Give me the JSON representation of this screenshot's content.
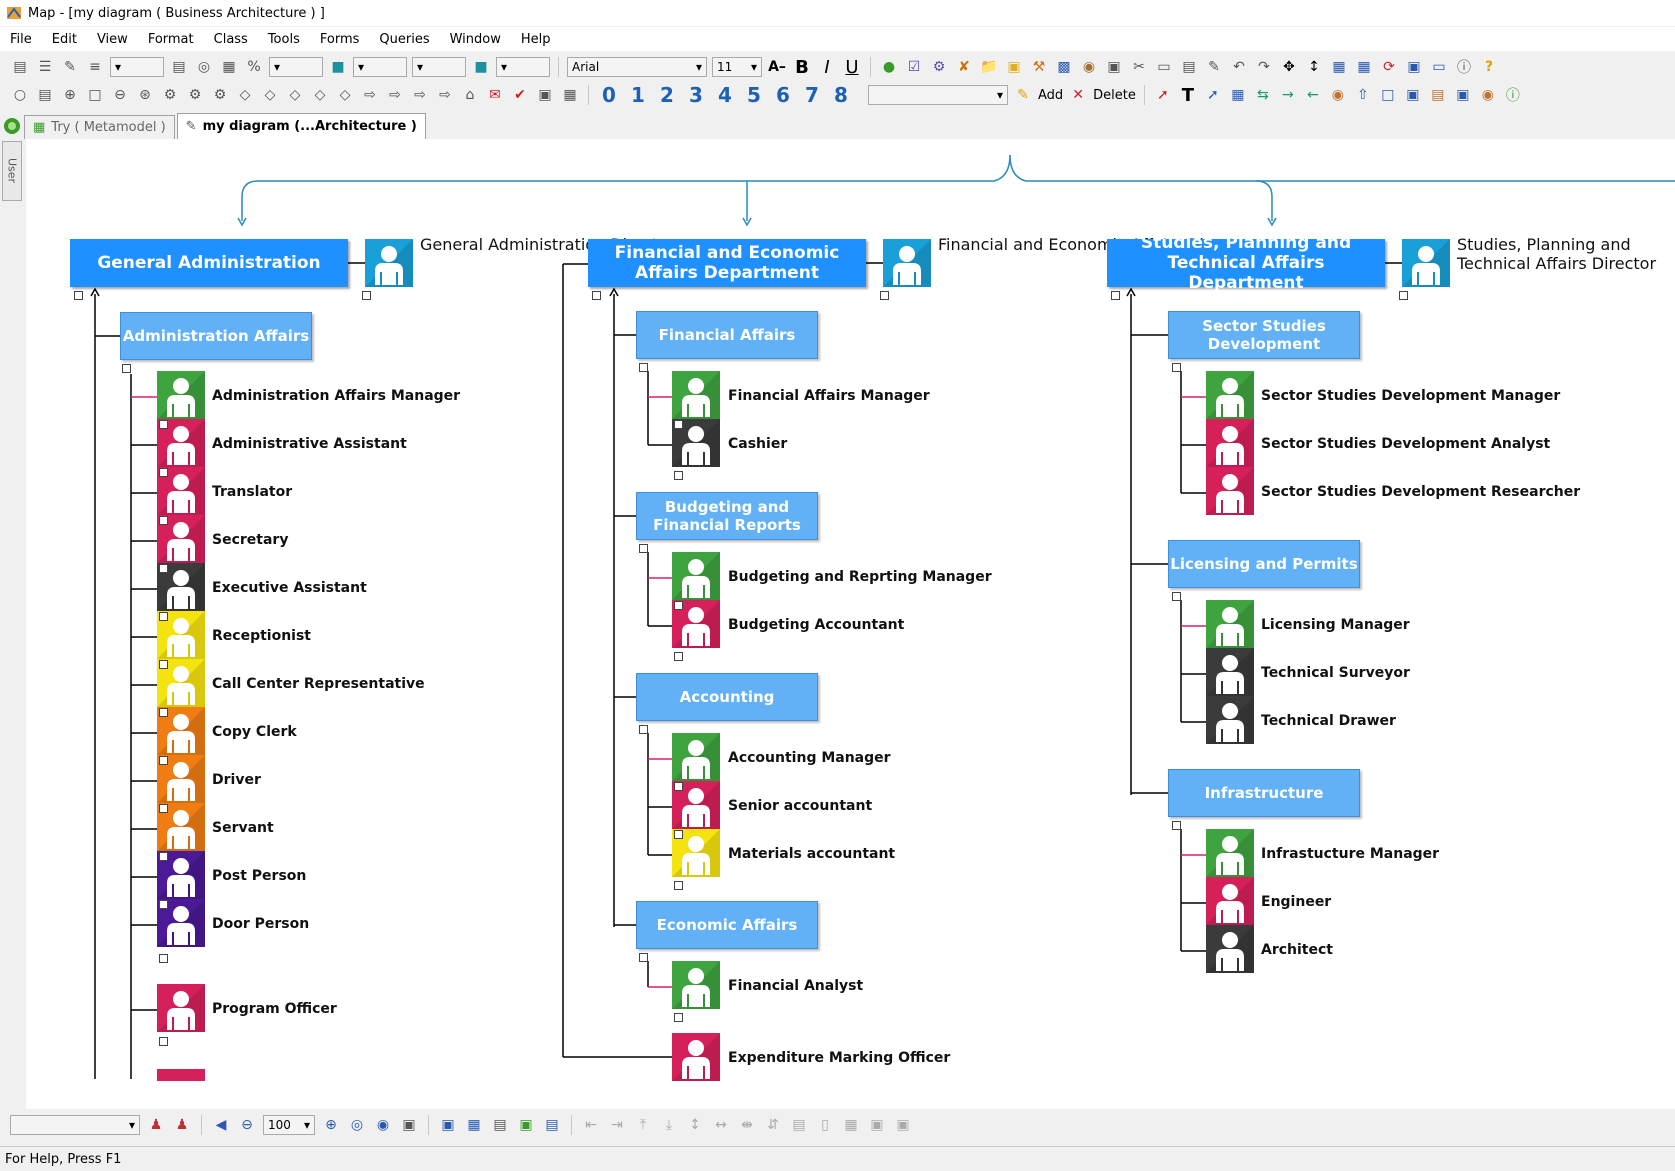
{
  "window": {
    "title": "Map - [my diagram ( Business Architecture ) ]"
  },
  "menu": [
    "File",
    "Edit",
    "View",
    "Format",
    "Class",
    "Tools",
    "Forms",
    "Queries",
    "Window",
    "Help"
  ],
  "toolbar": {
    "font_name": "Arial",
    "font_size": "11",
    "add_label": "Add",
    "delete_label": "Delete",
    "number_tools": [
      "0",
      "1",
      "2",
      "3",
      "4",
      "5",
      "6",
      "7",
      "8"
    ]
  },
  "tabs": [
    {
      "label": "Try ( Metamodel )"
    },
    {
      "label": "my diagram (...Architecture )"
    }
  ],
  "sidebar": {
    "label": "User"
  },
  "colors": {
    "green": "#3fa33f",
    "crimson": "#d6205a",
    "darkgray": "#3b3b3b",
    "yellow": "#f5e30f",
    "orange": "#f07d13",
    "purple": "#4b1a96",
    "teal": "#1aa0d8"
  },
  "diagram": {
    "departments": [
      {
        "name": "General Administration",
        "director": "General Administration Director"
      },
      {
        "name": "Financial and Economic Affairs Department",
        "director": "Financial and Economic Affairs Director"
      },
      {
        "name": "Studies, Planning and Technical Affairs Department",
        "director": "Studies, Planning and Technical Affairs Director"
      }
    ],
    "col1": {
      "unit": "Administration Affairs",
      "positions": [
        {
          "label": "Administration Affairs Manager",
          "color": "green"
        },
        {
          "label": "Administrative Assistant",
          "color": "crimson"
        },
        {
          "label": "Translator",
          "color": "crimson"
        },
        {
          "label": "Secretary",
          "color": "crimson"
        },
        {
          "label": "Executive Assistant",
          "color": "darkgray"
        },
        {
          "label": "Receptionist",
          "color": "yellow"
        },
        {
          "label": "Call Center Representative",
          "color": "yellow"
        },
        {
          "label": "Copy Clerk",
          "color": "orange"
        },
        {
          "label": "Driver",
          "color": "orange"
        },
        {
          "label": "Servant",
          "color": "orange"
        },
        {
          "label": "Post Person",
          "color": "purple"
        },
        {
          "label": "Door Person",
          "color": "purple"
        }
      ],
      "extra": {
        "label": "Program Officer",
        "color": "crimson"
      }
    },
    "col2": {
      "units": [
        {
          "name": "Financial Affairs",
          "positions": [
            {
              "label": "Financial Affairs Manager",
              "color": "green"
            },
            {
              "label": "Cashier",
              "color": "darkgray"
            }
          ]
        },
        {
          "name": "Budgeting and Financial Reports",
          "positions": [
            {
              "label": "Budgeting and Reprting Manager",
              "color": "green"
            },
            {
              "label": "Budgeting Accountant",
              "color": "crimson"
            }
          ]
        },
        {
          "name": "Accounting",
          "positions": [
            {
              "label": "Accounting Manager",
              "color": "green"
            },
            {
              "label": "Senior accountant",
              "color": "crimson"
            },
            {
              "label": "Materials accountant",
              "color": "yellow"
            }
          ]
        },
        {
          "name": "Economic Affairs",
          "positions": [
            {
              "label": "Financial Analyst",
              "color": "green"
            }
          ]
        }
      ],
      "extra": {
        "label": "Expenditure Marking Officer",
        "color": "crimson"
      }
    },
    "col3": {
      "units": [
        {
          "name": "Sector Studies Development",
          "positions": [
            {
              "label": "Sector Studies Development Manager",
              "color": "green"
            },
            {
              "label": "Sector Studies Development Analyst",
              "color": "crimson"
            },
            {
              "label": "Sector Studies Development Researcher",
              "color": "crimson"
            }
          ]
        },
        {
          "name": "Licensing and Permits",
          "positions": [
            {
              "label": "Licensing Manager",
              "color": "green"
            },
            {
              "label": "Technical Surveyor",
              "color": "darkgray"
            },
            {
              "label": "Technical Drawer",
              "color": "darkgray"
            }
          ]
        },
        {
          "name": "Infrastructure",
          "positions": [
            {
              "label": "Infrastucture Manager",
              "color": "green"
            },
            {
              "label": "Engineer",
              "color": "crimson"
            },
            {
              "label": "Architect",
              "color": "darkgray"
            }
          ]
        }
      ]
    }
  },
  "bottom": {
    "zoom": "100"
  },
  "status": {
    "text": "For Help, Press F1"
  }
}
